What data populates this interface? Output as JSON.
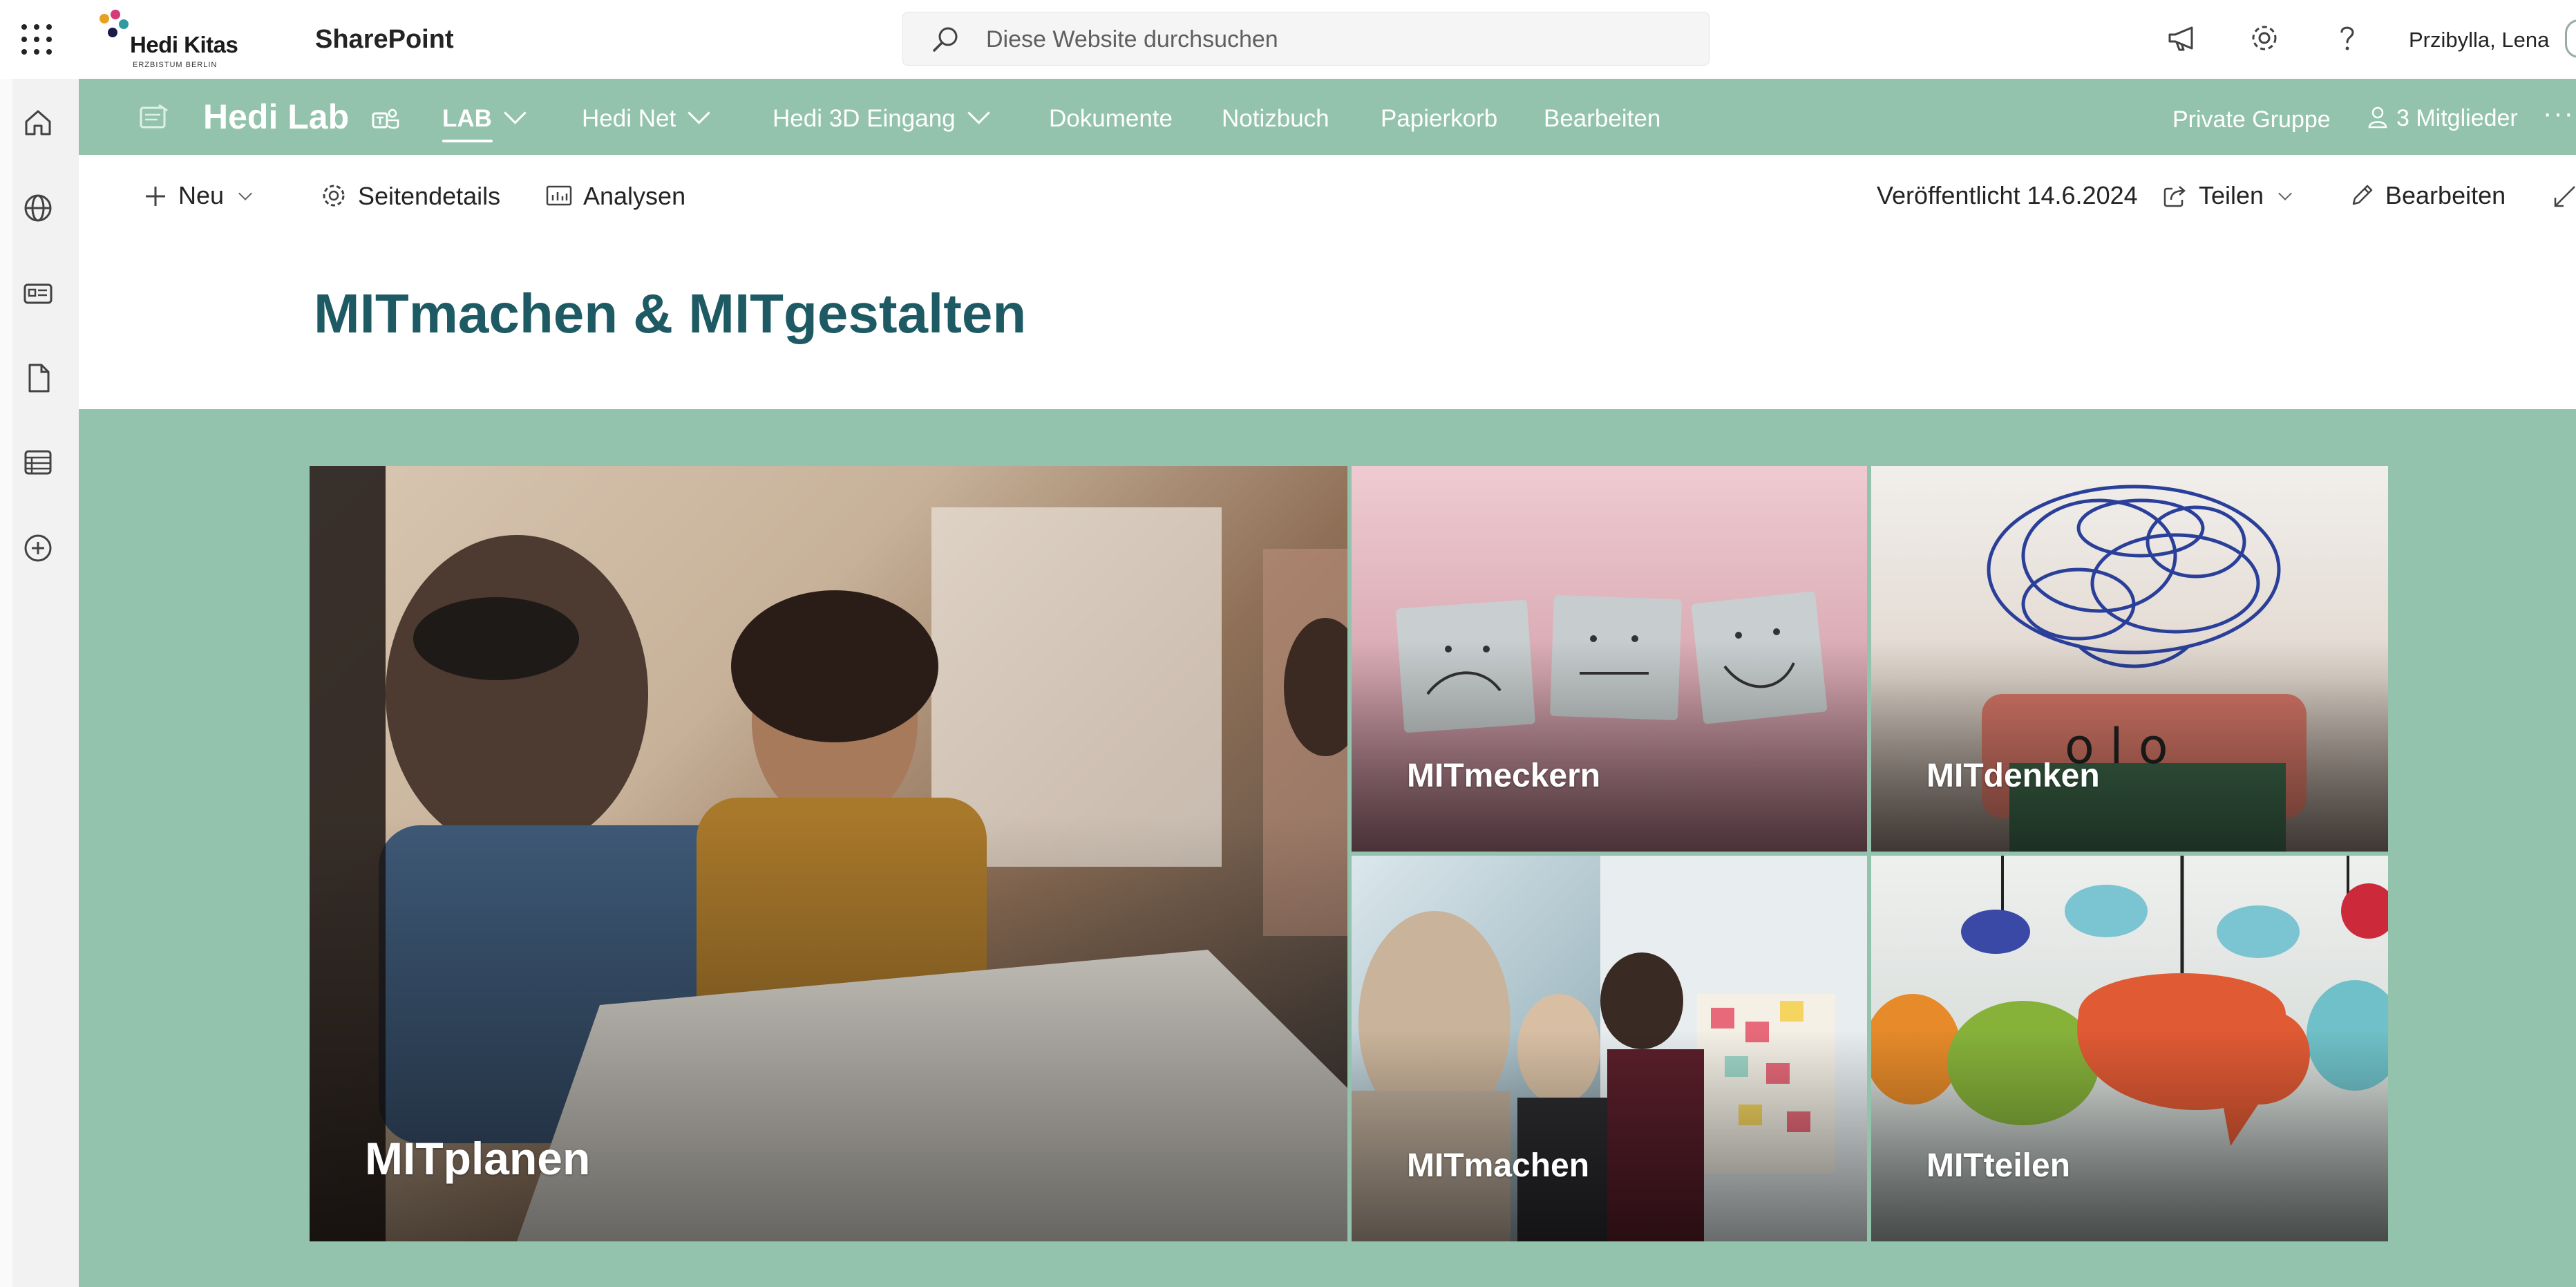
{
  "suitebar": {
    "org_name": "Hedi Kitas",
    "org_sub": "ERZBISTUM BERLIN",
    "app_name": "SharePoint",
    "search_placeholder": "Diese Website durchsuchen",
    "user_name": "Przibylla, Lena"
  },
  "hubnav": {
    "site_title": "Hedi Lab",
    "items": [
      {
        "label": "LAB",
        "has_dropdown": true,
        "active": true
      },
      {
        "label": "Hedi Net",
        "has_dropdown": true
      },
      {
        "label": "Hedi 3D Eingang",
        "has_dropdown": true
      },
      {
        "label": "Dokumente"
      },
      {
        "label": "Notizbuch"
      },
      {
        "label": "Papierkorb"
      },
      {
        "label": "Bearbeiten"
      }
    ],
    "privacy": "Private Gruppe",
    "members": "3 Mitglieder",
    "more": "···"
  },
  "commandbar": {
    "new_label": "Neu",
    "page_details_label": "Seitendetails",
    "analytics_label": "Analysen",
    "published_label": "Veröffentlicht 14.6.2024",
    "share_label": "Teilen",
    "edit_label": "Bearbeiten"
  },
  "page": {
    "title": "MITmachen & MITgestalten"
  },
  "hero": {
    "tiles": [
      {
        "label": "MITplanen"
      },
      {
        "label": "MITmeckern"
      },
      {
        "label": "MITdenken"
      },
      {
        "label": "MITmachen"
      },
      {
        "label": "MITteilen"
      }
    ]
  },
  "colors": {
    "hub_nav_bg": "#93c3ad",
    "title_color": "#1e5a64",
    "rail_bg": "#f2f2f2"
  }
}
